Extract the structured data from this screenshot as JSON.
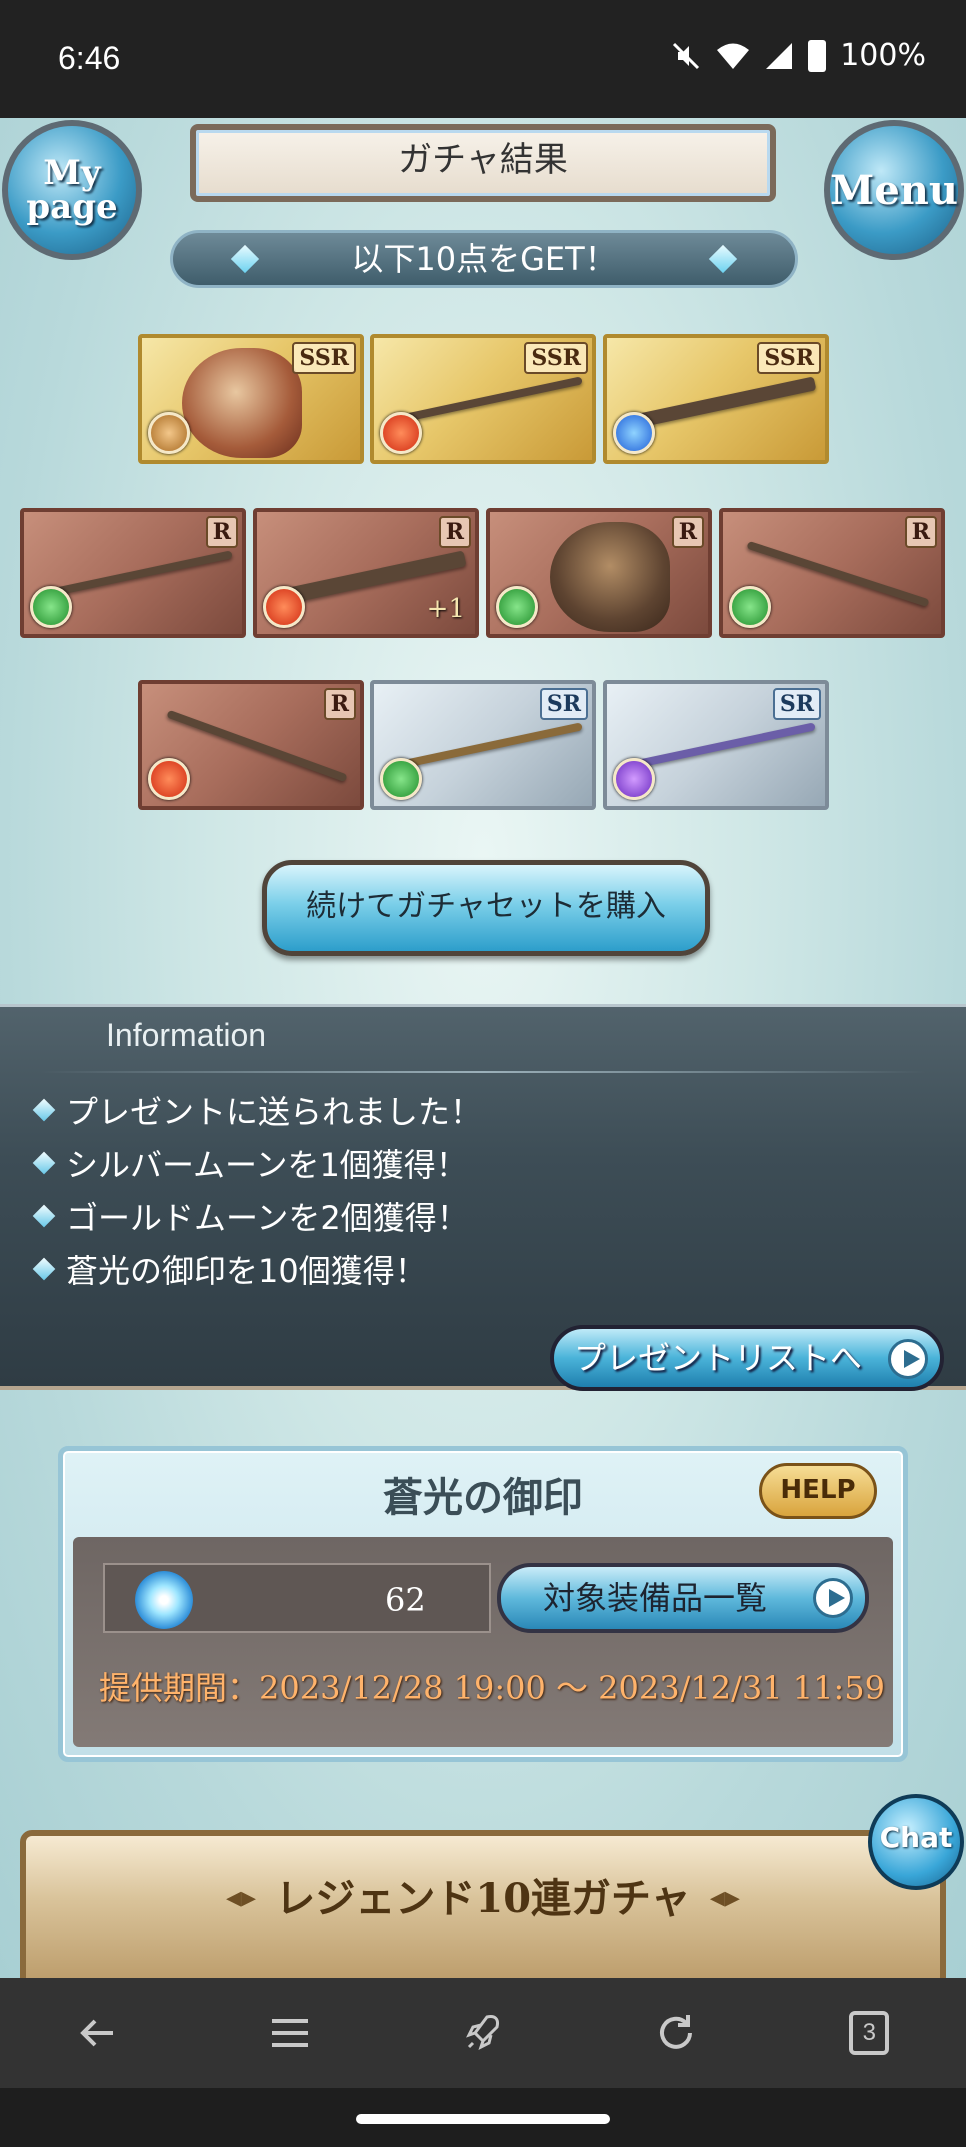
{
  "status_bar": {
    "time": "6:46",
    "battery": "100%"
  },
  "header": {
    "title": "ガチャ結果",
    "mypage_label": "My page",
    "menu_label": "Menu"
  },
  "result_banner": "以下10点をGET！",
  "cards": [
    {
      "rank": "SSR",
      "element": "earth",
      "type": "character"
    },
    {
      "rank": "SSR",
      "element": "fire",
      "type": "weapon"
    },
    {
      "rank": "SSR",
      "element": "water",
      "type": "weapon"
    },
    {
      "rank": "R",
      "element": "wind",
      "type": "weapon"
    },
    {
      "rank": "R",
      "element": "fire",
      "type": "weapon",
      "plus": "+1"
    },
    {
      "rank": "R",
      "element": "wind",
      "type": "summon"
    },
    {
      "rank": "R",
      "element": "wind",
      "type": "weapon"
    },
    {
      "rank": "R",
      "element": "fire",
      "type": "weapon"
    },
    {
      "rank": "SR",
      "element": "wind",
      "type": "weapon"
    },
    {
      "rank": "SR",
      "element": "dark",
      "type": "weapon"
    }
  ],
  "buy_button": "続けてガチャセットを購入",
  "information": {
    "title": "Information",
    "items": [
      "プレゼントに送られました！",
      "シルバームーンを1個獲得！",
      "ゴールドムーンを2個獲得！",
      "蒼光の御印を10個獲得！"
    ],
    "present_button": "プレゼントリストへ"
  },
  "seal": {
    "title": "蒼光の御印",
    "help": "HELP",
    "count": "62",
    "equip_button": "対象装備品一覧",
    "period": "提供期間：2023/12/28 19:00 〜 2023/12/31 11:59"
  },
  "legend_banner": "レジェンド10連ガチャ",
  "chat_label": "Chat",
  "browser": {
    "tab_count": "3"
  }
}
